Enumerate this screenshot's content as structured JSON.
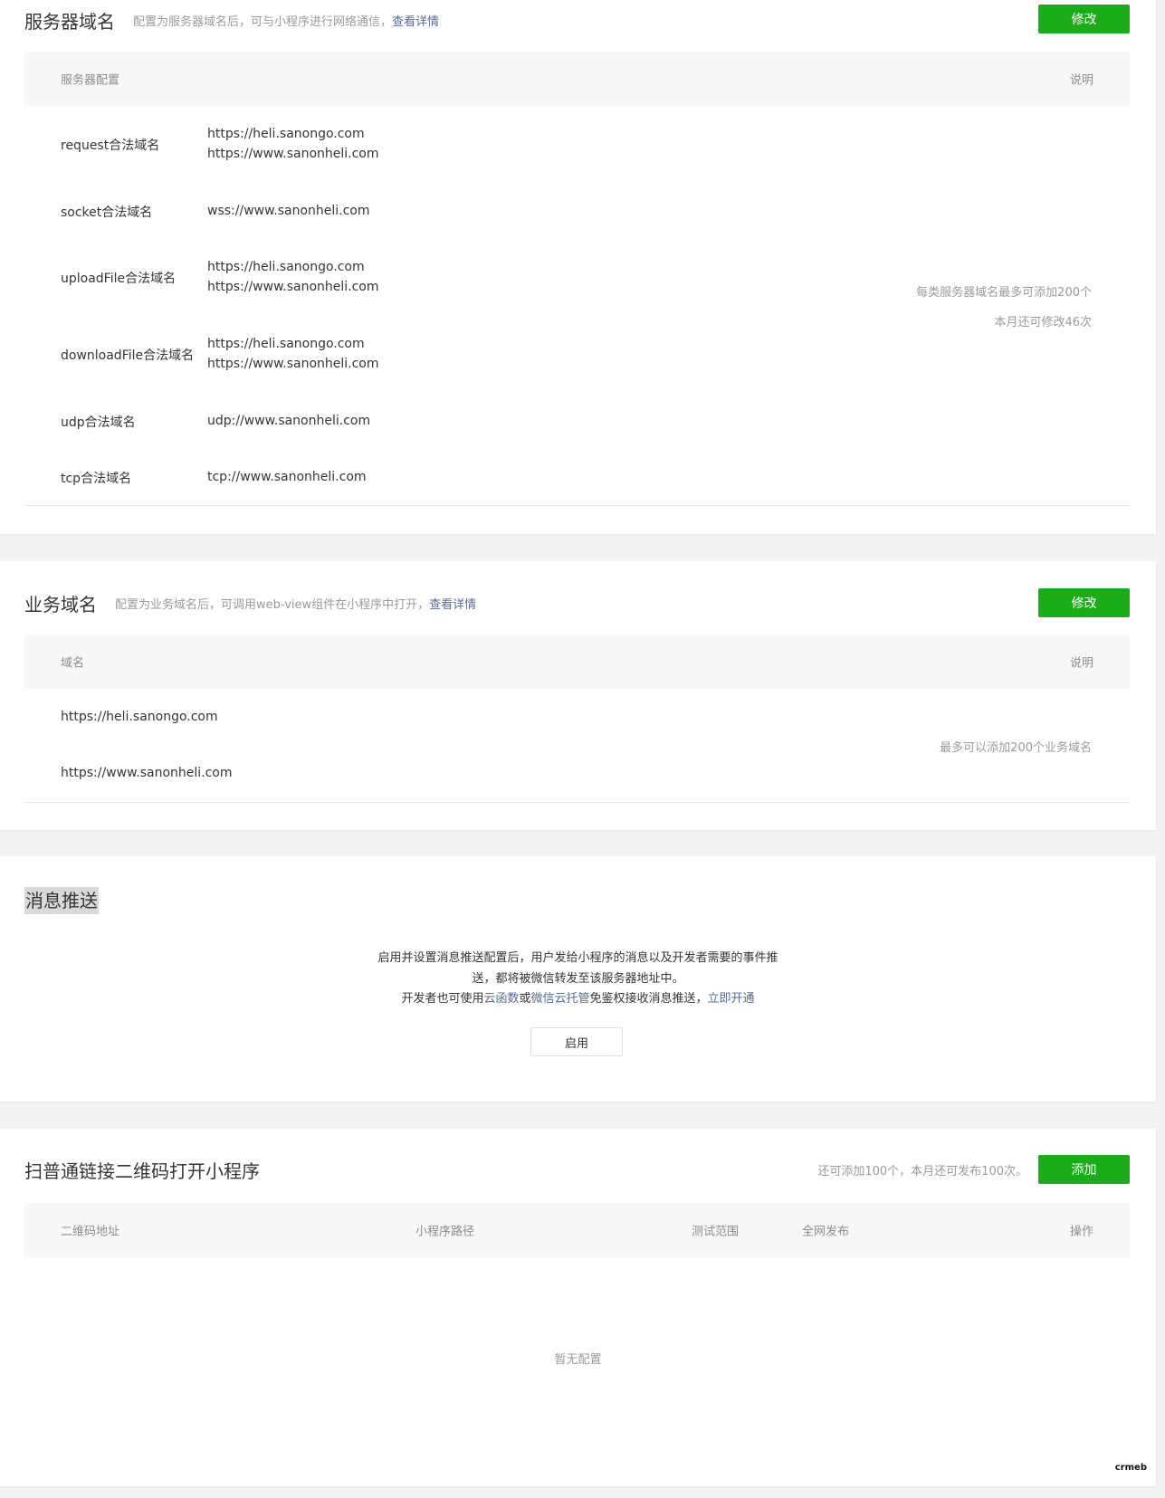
{
  "server_domain": {
    "title": "服务器域名",
    "desc": "配置为服务器域名后，可与小程序进行网络通信，",
    "desc_link": "查看详情",
    "edit_button": "修改",
    "header_config": "服务器配置",
    "header_note": "说明",
    "rows": [
      {
        "label": "request合法域名",
        "values": [
          "https://heli.sanongo.com",
          "https://www.sanonheli.com"
        ]
      },
      {
        "label": "socket合法域名",
        "values": [
          "wss://www.sanonheli.com"
        ]
      },
      {
        "label": "uploadFile合法域名",
        "values": [
          "https://heli.sanongo.com",
          "https://www.sanonheli.com"
        ]
      },
      {
        "label": "downloadFile合法域名",
        "values": [
          "https://heli.sanongo.com",
          "https://www.sanonheli.com"
        ]
      },
      {
        "label": "udp合法域名",
        "values": [
          "udp://www.sanonheli.com"
        ]
      },
      {
        "label": "tcp合法域名",
        "values": [
          "tcp://www.sanonheli.com"
        ]
      }
    ],
    "note_line1": "每类服务器域名最多可添加200个",
    "note_line2": "本月还可修改46次"
  },
  "business_domain": {
    "title": "业务域名",
    "desc": "配置为业务域名后，可调用web-view组件在小程序中打开，",
    "desc_link": "查看详情",
    "edit_button": "修改",
    "header_domain": "域名",
    "header_note": "说明",
    "domains": [
      "https://heli.sanongo.com",
      "https://www.sanonheli.com"
    ],
    "note": "最多可以添加200个业务域名"
  },
  "message_push": {
    "title": "消息推送",
    "text_line1": "启用并设置消息推送配置后，用户发给小程序的消息以及开发者需要的事件推",
    "text_line2": "送，都将被微信转发至该服务器地址中。",
    "text_line3_a": "开发者也可使用",
    "link_cloud_func": "云函数",
    "text_line3_b": "或",
    "link_cloud_host": "微信云托管",
    "text_line3_c": "免鉴权接收消息推送，",
    "link_enable_now": "立即开通",
    "enable_button": "启用"
  },
  "qrcode": {
    "title": "扫普通链接二维码打开小程序",
    "quota": "还可添加100个，本月还可发布100次。",
    "add_button": "添加",
    "columns": [
      "二维码地址",
      "小程序路径",
      "测试范围",
      "全网发布",
      "操作"
    ],
    "empty": "暂无配置"
  },
  "logo_text": "crmeb",
  "colors": {
    "accent_green": "#1aad19",
    "link_blue": "#576b95"
  }
}
